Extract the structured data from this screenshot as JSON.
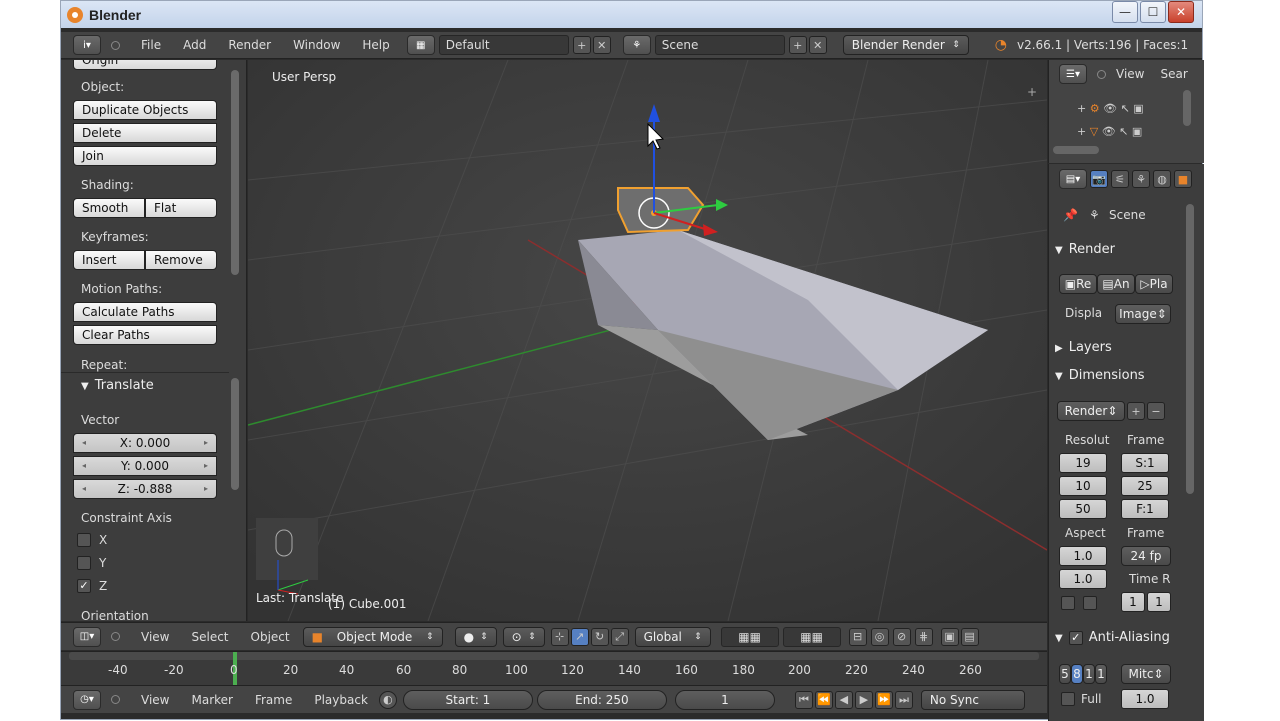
{
  "window": {
    "title": "Blender",
    "minimize": "—",
    "maximize": "☐",
    "close": "✕"
  },
  "infobar": {
    "menus": [
      "File",
      "Add",
      "Render",
      "Window",
      "Help"
    ],
    "layout": "Default",
    "scene": "Scene",
    "engine": "Blender Render",
    "stats": "v2.66.1 | Verts:196 | Faces:1"
  },
  "toolshelf": {
    "top_cut": "Origin",
    "object_heading": "Object:",
    "duplicate": "Duplicate Objects",
    "delete": "Delete",
    "join": "Join",
    "shading_heading": "Shading:",
    "smooth": "Smooth",
    "flat": "Flat",
    "keyframes_heading": "Keyframes:",
    "insert": "Insert",
    "remove": "Remove",
    "motion_heading": "Motion Paths:",
    "calc_paths": "Calculate Paths",
    "clear_paths": "Clear Paths",
    "repeat_heading": "Repeat:",
    "translate_panel": "Translate",
    "vector_label": "Vector",
    "x": "X: 0.000",
    "y": "Y: 0.000",
    "z": "Z: -0.888",
    "constraint_heading": "Constraint Axis",
    "cx": "X",
    "cy": "Y",
    "cz": "Z",
    "orientation": "Orientation"
  },
  "viewport": {
    "view_label": "User Persp",
    "object_label": "(1) Cube.001",
    "last_op": "Last: Translate"
  },
  "view_header": {
    "menus": [
      "View",
      "Select",
      "Object"
    ],
    "mode": "Object Mode",
    "orientation": "Global"
  },
  "timeline": {
    "marks": [
      "-40",
      "-20",
      "0",
      "20",
      "40",
      "60",
      "80",
      "100",
      "120",
      "140",
      "160",
      "180",
      "200",
      "220",
      "240",
      "260"
    ],
    "menus": [
      "View",
      "Marker",
      "Frame",
      "Playback"
    ],
    "start": "Start: 1",
    "end": "End: 250",
    "current": "1",
    "sync": "No Sync"
  },
  "outliner": {
    "view": "View",
    "search": "Sear"
  },
  "properties": {
    "scene": "Scene",
    "render_section": "Render",
    "render_btn": "Re",
    "anim_btn": "An",
    "play_btn": "Pla",
    "display_label": "Displa",
    "display_value": "Image",
    "layers_section": "Layers",
    "dimensions_section": "Dimensions",
    "preset": "Render",
    "resol_label": "Resolut",
    "frame_label": "Frame",
    "res_x": "19",
    "res_y": "10",
    "res_pct": "50",
    "frame_start": "S:1",
    "frame_end": "25",
    "frame_step": "F:1",
    "aspect_label": "Aspect",
    "frame_rate_label": "Frame",
    "aspect_x": "1.0",
    "aspect_y": "1.0",
    "fps": "24 fp",
    "time_label": "Time R",
    "time_a": "1",
    "time_b": "1",
    "aa_section": "Anti-Aliasing",
    "aa_samples": [
      "5",
      "8",
      "1",
      "1"
    ],
    "filter": "Mitc",
    "full": "Full",
    "filter_size": "1.0"
  },
  "colors": {
    "accent": "#e8842b",
    "selected": "#f0a030",
    "axis_x": "#c0392b",
    "axis_y": "#2ecc40",
    "axis_z": "#2050e0"
  }
}
